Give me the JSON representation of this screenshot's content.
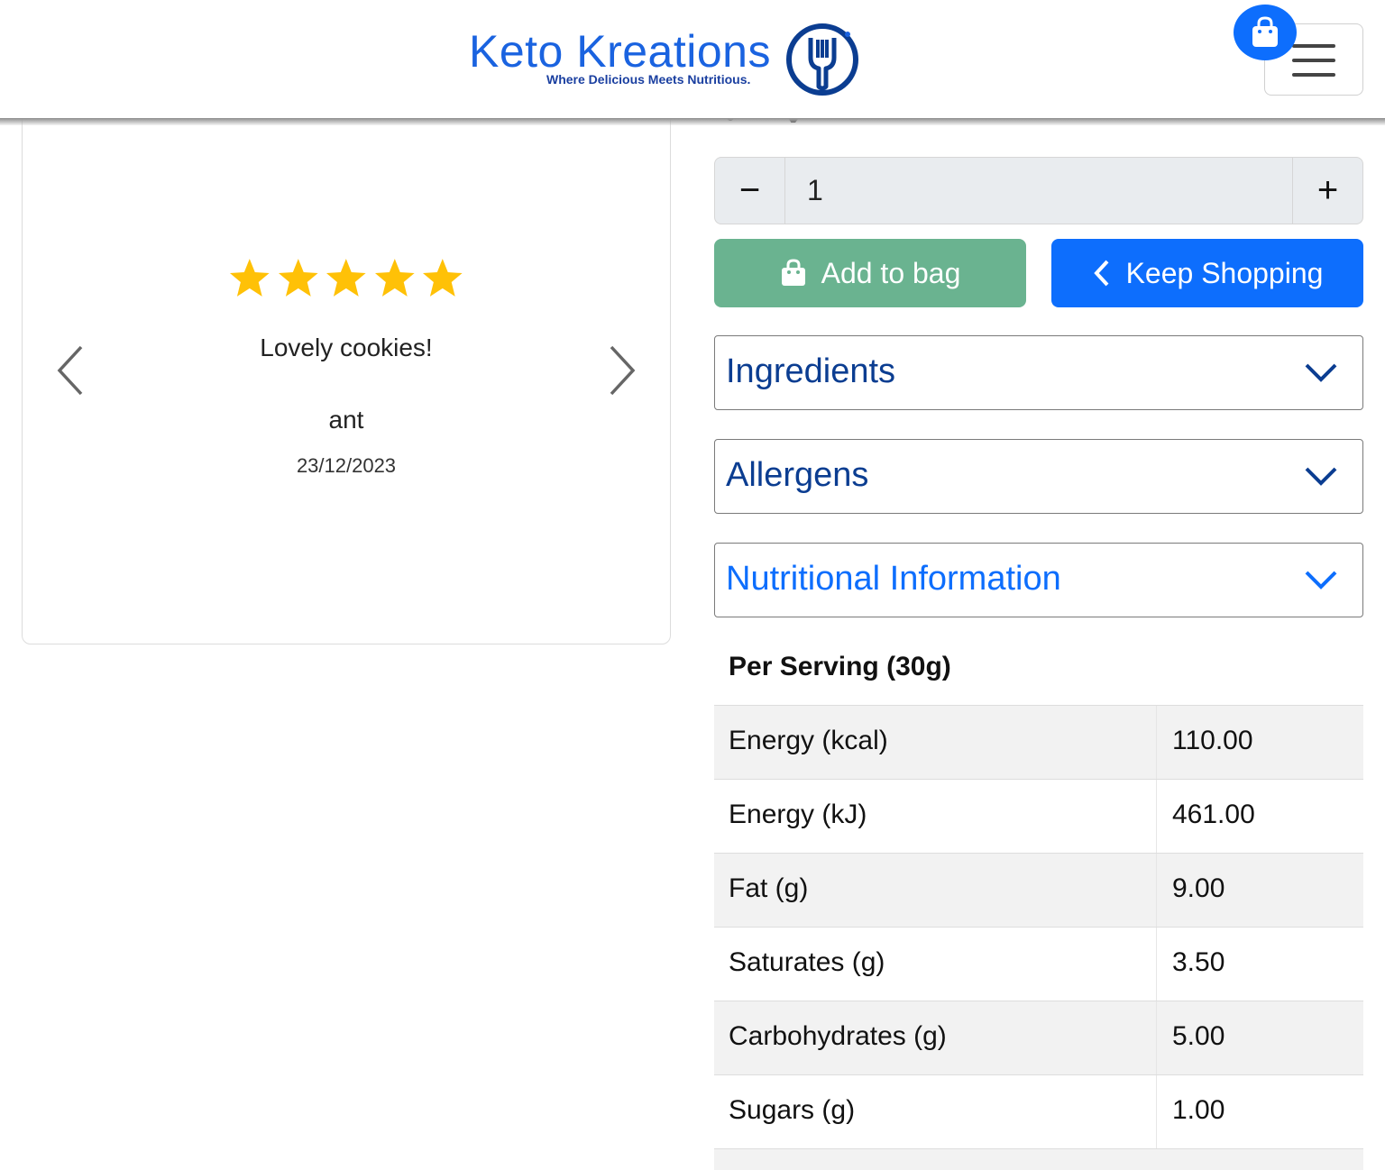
{
  "header": {
    "logo_text": "Keto Kreations",
    "tagline": "Where Delicious Meets Nutritious.",
    "menu_icon": "hamburger-icon",
    "bag_icon": "shopping-bag-icon"
  },
  "review": {
    "rating": 5,
    "max_rating": 5,
    "text": "Lovely cookies!",
    "author": "ant",
    "date": "23/12/2023"
  },
  "quantity": {
    "minus": "−",
    "value": "1",
    "plus": "+"
  },
  "actions": {
    "add_to_bag": "Add to bag",
    "keep_shopping": "Keep Shopping"
  },
  "accordion": [
    {
      "label": "Ingredients"
    },
    {
      "label": "Allergens"
    },
    {
      "label": "Nutritional Information"
    }
  ],
  "nutrition": {
    "heading": "Per Serving (30g)",
    "rows": [
      {
        "label": "Energy (kcal)",
        "value": "110.00"
      },
      {
        "label": "Energy (kJ)",
        "value": "461.00"
      },
      {
        "label": "Fat (g)",
        "value": "9.00"
      },
      {
        "label": "Saturates (g)",
        "value": "3.50"
      },
      {
        "label": "Carbohydrates (g)",
        "value": "5.00"
      },
      {
        "label": "Sugars (g)",
        "value": "1.00"
      }
    ]
  },
  "colors": {
    "brand_blue": "#0d6efd",
    "add_green": "#6ab390",
    "star_gold": "#ffc107",
    "accordion_text": "#0b3d91"
  }
}
